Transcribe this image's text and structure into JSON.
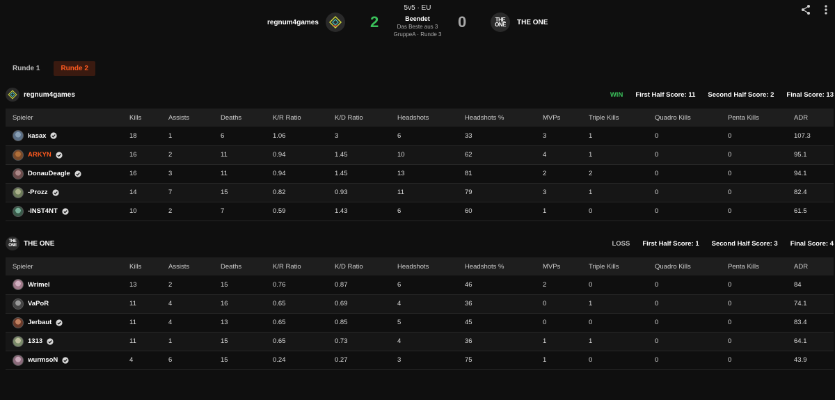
{
  "match": {
    "format": "5v5 · EU",
    "status": "Beendet",
    "best_of": "Das Beste aus 3",
    "group_round": "GruppeA · Runde 3",
    "team_left": "regnum4games",
    "team_right": "THE ONE",
    "logo_right_text": "THE ONE",
    "score_left": "2",
    "score_right": "0",
    "score_left_color": "#3ac05a",
    "score_right_color": "#a8a8a8"
  },
  "round_tabs": [
    "Runde 1",
    "Runde 2"
  ],
  "active_round": "Runde 2",
  "columns": [
    "Spieler",
    "Kills",
    "Assists",
    "Deaths",
    "K/R Ratio",
    "K/D Ratio",
    "Headshots",
    "Headshots %",
    "MVPs",
    "Triple Kills",
    "Quadro Kills",
    "Penta Kills",
    "ADR"
  ],
  "teams": [
    {
      "name": "regnum4games",
      "result": "WIN",
      "first_half": "First Half Score: 11",
      "second_half": "Second Half Score: 2",
      "final": "Final Score: 13",
      "players": [
        {
          "name": "kasax",
          "stats": [
            "18",
            "1",
            "6",
            "1.06",
            "3",
            "6",
            "33",
            "3",
            "1",
            "0",
            "0",
            "107.3"
          ]
        },
        {
          "name": "ARKYN",
          "stats": [
            "16",
            "2",
            "11",
            "0.94",
            "1.45",
            "10",
            "62",
            "4",
            "1",
            "0",
            "0",
            "95.1"
          ]
        },
        {
          "name": "DonauDeagle",
          "stats": [
            "16",
            "3",
            "11",
            "0.94",
            "1.45",
            "13",
            "81",
            "2",
            "2",
            "0",
            "0",
            "94.1"
          ]
        },
        {
          "name": "-Prozz",
          "stats": [
            "14",
            "7",
            "15",
            "0.82",
            "0.93",
            "11",
            "79",
            "3",
            "1",
            "0",
            "0",
            "82.4"
          ]
        },
        {
          "name": "-INST4NT",
          "stats": [
            "10",
            "2",
            "7",
            "0.59",
            "1.43",
            "6",
            "60",
            "1",
            "0",
            "0",
            "0",
            "61.5"
          ]
        }
      ]
    },
    {
      "name": "THE ONE",
      "result": "LOSS",
      "first_half": "First Half Score: 1",
      "second_half": "Second Half Score: 3",
      "final": "Final Score: 4",
      "players": [
        {
          "name": "Wrimel",
          "stats": [
            "13",
            "2",
            "15",
            "0.76",
            "0.87",
            "6",
            "46",
            "2",
            "0",
            "0",
            "0",
            "84"
          ]
        },
        {
          "name": "VaPoR",
          "stats": [
            "11",
            "4",
            "16",
            "0.65",
            "0.69",
            "4",
            "36",
            "0",
            "1",
            "0",
            "0",
            "74.1"
          ]
        },
        {
          "name": "Jerbaut",
          "stats": [
            "11",
            "4",
            "13",
            "0.65",
            "0.85",
            "5",
            "45",
            "0",
            "0",
            "0",
            "0",
            "83.4"
          ]
        },
        {
          "name": "1313",
          "stats": [
            "11",
            "1",
            "15",
            "0.65",
            "0.73",
            "4",
            "36",
            "1",
            "1",
            "0",
            "0",
            "64.1"
          ]
        },
        {
          "name": "wurmsoN",
          "stats": [
            "4",
            "6",
            "15",
            "0.24",
            "0.27",
            "3",
            "75",
            "1",
            "0",
            "0",
            "0",
            "43.9"
          ]
        }
      ]
    }
  ],
  "colors": {
    "accent": "#ff5a1f",
    "win": "#3ac05a",
    "background": "#0f0f0f",
    "header_row": "#1e1e1e"
  },
  "icons": {
    "share": "share-icon",
    "menu": "more-vertical-icon",
    "verified": "verified-check-icon"
  }
}
